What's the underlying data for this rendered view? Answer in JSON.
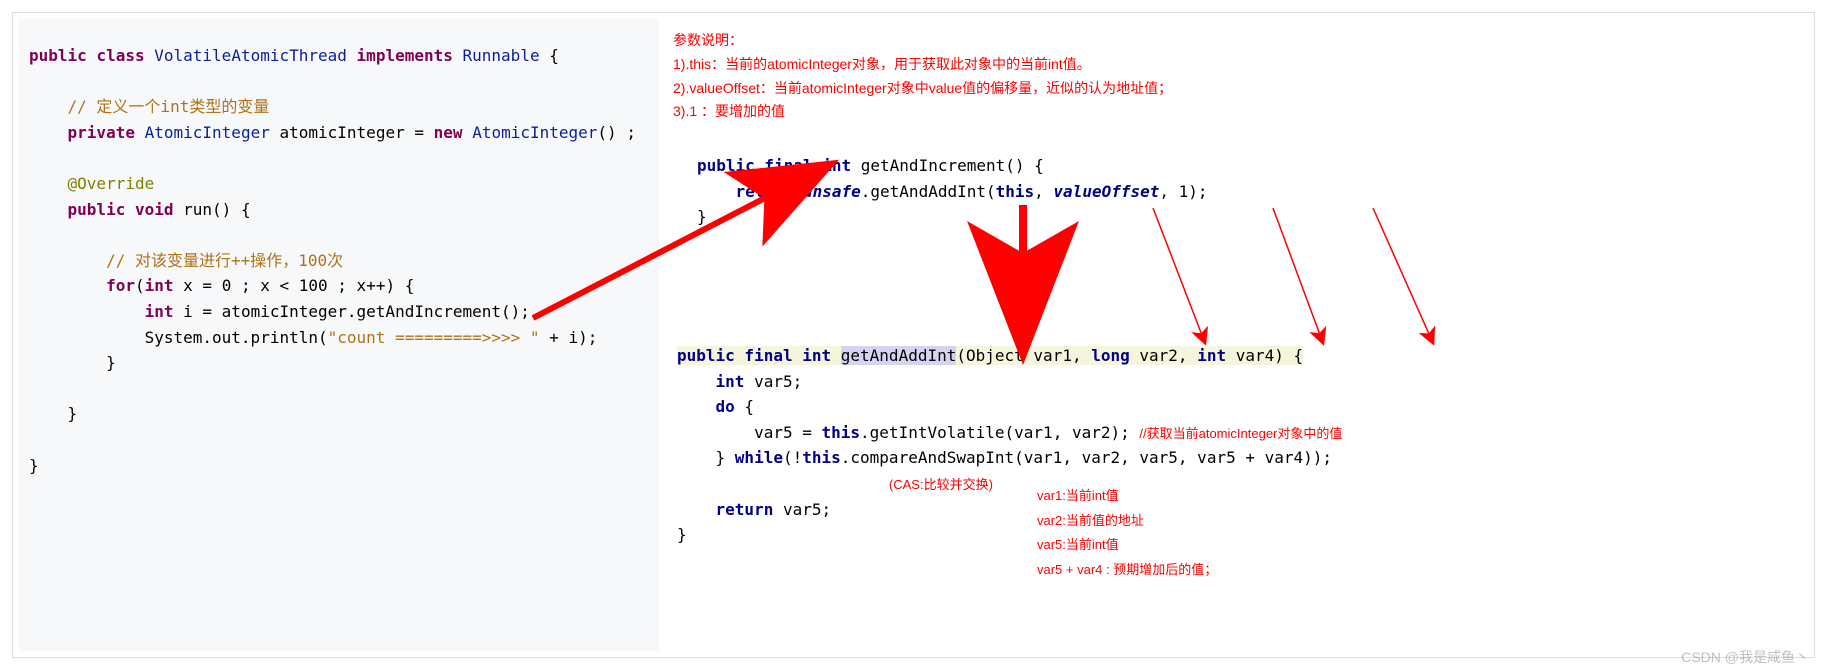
{
  "left_code": {
    "l1a": "public",
    "l1b": "class",
    "l1c": "VolatileAtomicThread",
    "l1d": "implements",
    "l1e": "Runnable",
    "l1f": " {",
    "l3": "    // 定义一个int类型的变量",
    "l4a": "    private",
    "l4b": "AtomicInteger",
    "l4c": "atomicInteger",
    "l4d": "=",
    "l4e": "new",
    "l4f": "AtomicInteger",
    "l4g": "() ;",
    "l6": "    @Override",
    "l7a": "    public",
    "l7b": "void",
    "l7c": "run() {",
    "l9": "        // 对该变量进行++操作，100次",
    "l10a": "        for",
    "l10b": "(",
    "l10c": "int",
    "l10d": "x = 0 ; x < 100 ; x++) {",
    "l11a": "            int",
    "l11b": "i = atomicInteger.getAndIncrement();",
    "l12a": "            System.out.println(",
    "l12b": "\"count =========>>>> \"",
    "l12c": " + i);",
    "l13": "        }",
    "l15": "    }",
    "l17": "}"
  },
  "anno_top": {
    "title": "参数说明：",
    "l1": "1).this：当前的atomicInteger对象，用于获取此对象中的当前int值。",
    "l2": "2).valueOffset：当前atomicInteger对象中value值的偏移量，近似的认为地址值；",
    "l3": "3).1 ：要增加的值"
  },
  "right1": {
    "r1a": "public final int",
    "r1b": "getAndIncrement",
    "r1c": "() {",
    "r2a": "    return ",
    "r2b": "unsafe",
    "r2c": ".getAndAddInt(",
    "r2d": "this",
    "r2e": ", ",
    "r2f": "valueOffset",
    "r2g": ", 1);",
    "r3": "}"
  },
  "right2": {
    "s1a": "public final int ",
    "s1b": "getAndAddInt",
    "s1c": "(Object var1, ",
    "s1d": "long",
    "s1e": " var2, ",
    "s1f": "int",
    "s1g": " var4) {",
    "s2": "    int var5;",
    "s2a": "    int",
    "s2b": " var5;",
    "s3a": "    do",
    "s3b": " {",
    "s4": "        var5 = ",
    "s4b": "this",
    "s4c": ".getIntVolatile(var1, var2); ",
    "s4d": "//获取当前atomicInteger对象中的值",
    "s5a": "    } ",
    "s5b": "while",
    "s5c": "(!",
    "s5d": "this",
    "s5e": ".compareAndSwapInt(var1, var2, var5, var5 + var4));",
    "cas": "(CAS:比较并交换)",
    "s6a": "    return",
    "s6b": " var5;",
    "s7": "}"
  },
  "vars": {
    "v1": "var1:当前int值",
    "v2": "var2:当前值的地址",
    "v3": "var5:当前int值",
    "v4": "var5 + var4 : 预期增加后的值；"
  },
  "watermark": "CSDN @我是咸鱼丶"
}
